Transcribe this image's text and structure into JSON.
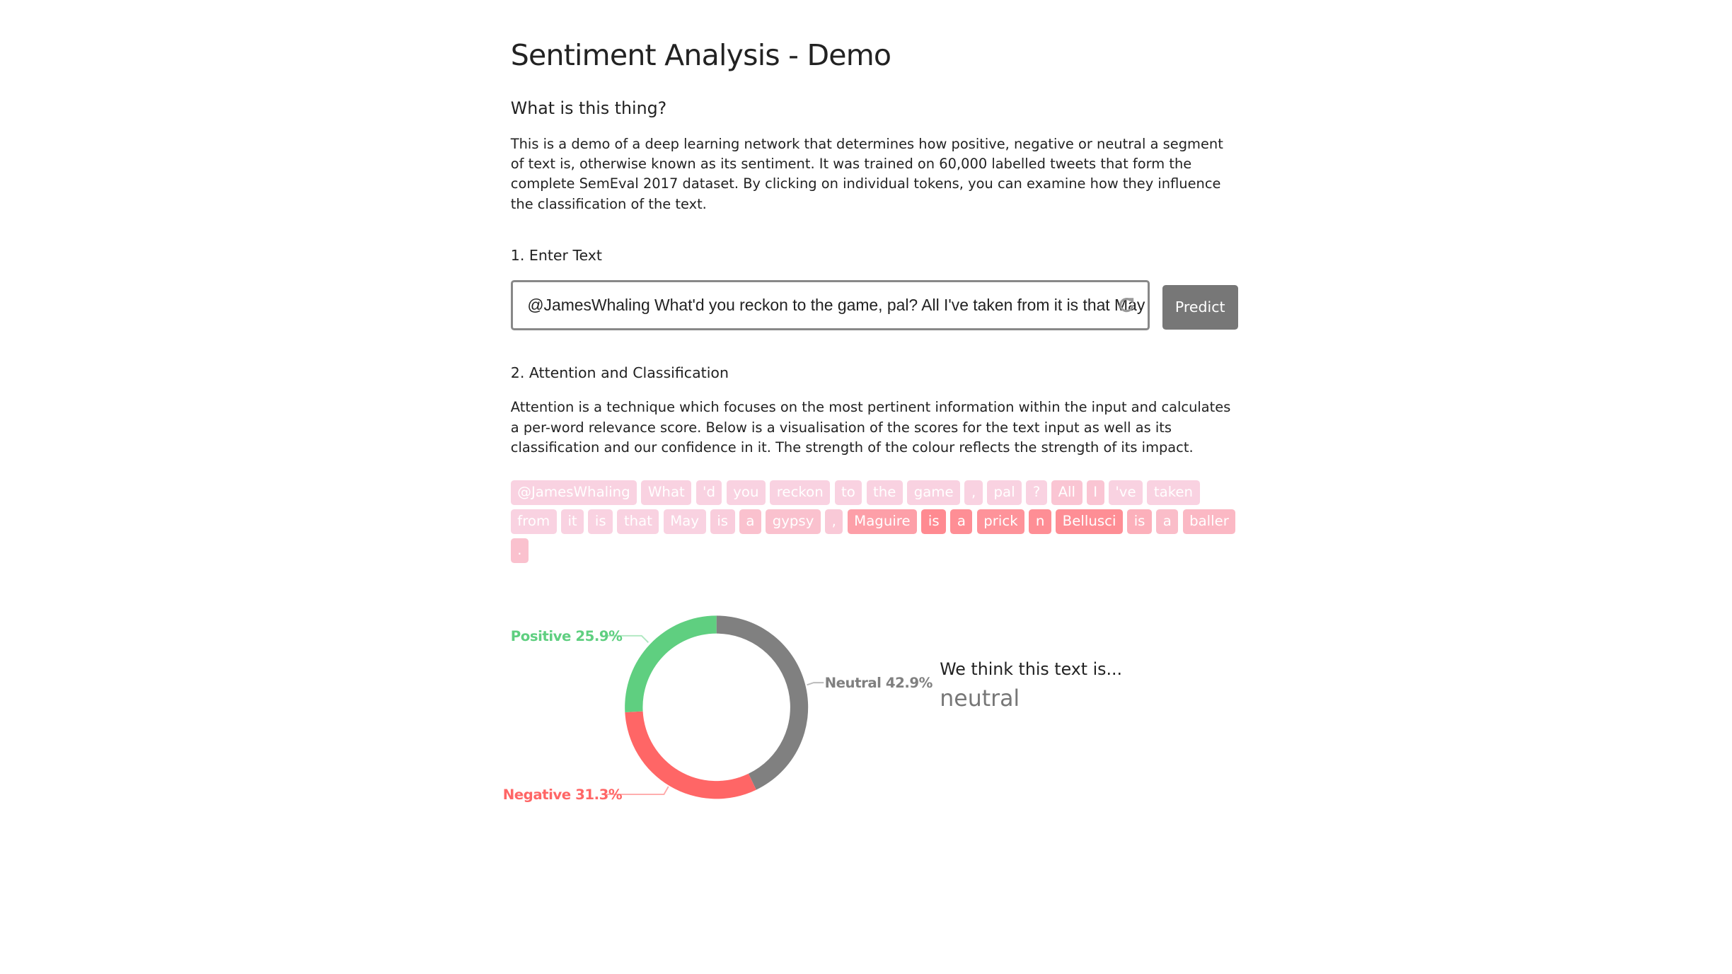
{
  "title": "Sentiment Analysis - Demo",
  "about": {
    "heading": "What is this thing?",
    "body": "This is a demo of a deep learning network that determines how positive, negative or neutral a segment of text is, otherwise known as its sentiment. It was trained on 60,000 labelled tweets that form the complete SemEval 2017 dataset. By clicking on individual tokens, you can examine how they influence the classification of the text."
  },
  "step1": {
    "heading": "1. Enter Text",
    "input_value": "@JamesWhaling What'd you reckon to the game, pal? All I've taken from it is that May is a gypsy, Maguire is a prick n Bellusci is a baller.",
    "refresh_icon": "refresh-icon",
    "predict_label": "Predict"
  },
  "step2": {
    "heading": "2. Attention and Classification",
    "body": "Attention is a technique which focuses on the most pertinent information within the input and calculates a per-word relevance score. Below is a visualisation of the scores for the text input as well as its classification and our confidence in it. The strength of the colour reflects the strength of its impact."
  },
  "tokens": [
    {
      "t": "@JamesWhaling",
      "w": 0.1
    },
    {
      "t": "What",
      "w": 0.1
    },
    {
      "t": "'d",
      "w": 0.1
    },
    {
      "t": "you",
      "w": 0.1
    },
    {
      "t": "reckon",
      "w": 0.1
    },
    {
      "t": "to",
      "w": 0.1
    },
    {
      "t": "the",
      "w": 0.1
    },
    {
      "t": "game",
      "w": 0.1
    },
    {
      "t": ",",
      "w": 0.1
    },
    {
      "t": "pal",
      "w": 0.1
    },
    {
      "t": "?",
      "w": 0.1
    },
    {
      "t": "All",
      "w": 0.25
    },
    {
      "t": "I",
      "w": 0.25
    },
    {
      "t": "'ve",
      "w": 0.1
    },
    {
      "t": "taken",
      "w": 0.1
    },
    {
      "t": "from",
      "w": 0.1
    },
    {
      "t": "it",
      "w": 0.1
    },
    {
      "t": "is",
      "w": 0.1
    },
    {
      "t": "that",
      "w": 0.1
    },
    {
      "t": "May",
      "w": 0.1
    },
    {
      "t": "is",
      "w": 0.15
    },
    {
      "t": "a",
      "w": 0.3
    },
    {
      "t": "gypsy",
      "w": 0.3
    },
    {
      "t": ",",
      "w": 0.2
    },
    {
      "t": "Maguire",
      "w": 0.7
    },
    {
      "t": "is",
      "w": 0.95
    },
    {
      "t": "a",
      "w": 0.9
    },
    {
      "t": "prick",
      "w": 0.85
    },
    {
      "t": "n",
      "w": 0.9
    },
    {
      "t": "Bellusci",
      "w": 0.9
    },
    {
      "t": "is",
      "w": 0.5
    },
    {
      "t": "a",
      "w": 0.35
    },
    {
      "t": "baller",
      "w": 0.4
    },
    {
      "t": ".",
      "w": 0.3
    }
  ],
  "chart_data": {
    "type": "pie",
    "donut": true,
    "slices": [
      {
        "name": "Neutral",
        "value": 42.9,
        "label": "Neutral 42.9%",
        "color": "#808080"
      },
      {
        "name": "Negative",
        "value": 31.3,
        "label": "Negative 31.3%",
        "color": "#ff6666"
      },
      {
        "name": "Positive",
        "value": 25.9,
        "label": "Positive 25.9%",
        "color": "#5fcf80"
      }
    ]
  },
  "result": {
    "prefix": "We think this text is...",
    "label": "neutral"
  }
}
